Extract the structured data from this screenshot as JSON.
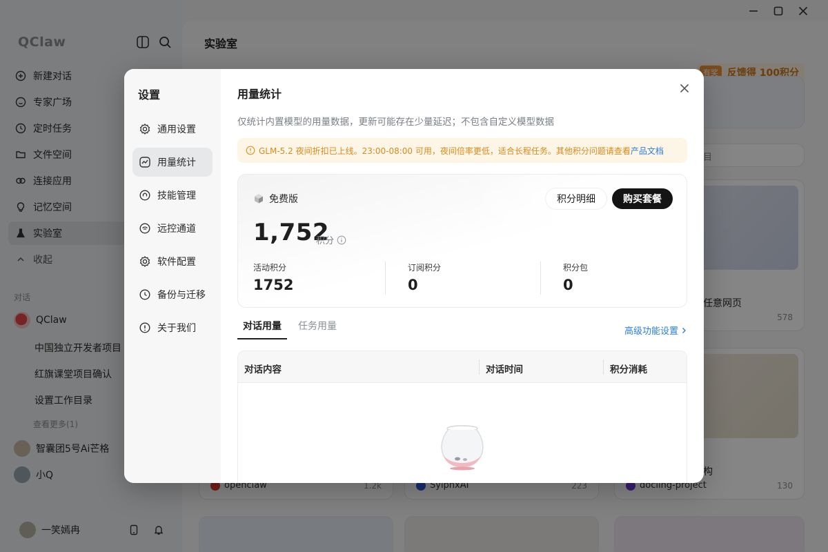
{
  "app": {
    "brand": "QClaw",
    "nav": [
      {
        "label": "新建对话",
        "icon": "plus-circle-icon"
      },
      {
        "label": "专家广场",
        "icon": "smile-icon"
      },
      {
        "label": "定时任务",
        "icon": "clock-icon"
      },
      {
        "label": "文件空间",
        "icon": "folder-icon"
      },
      {
        "label": "连接应用",
        "icon": "link-icon"
      },
      {
        "label": "记忆空间",
        "icon": "bulb-icon"
      },
      {
        "label": "实验室",
        "icon": "flask-icon"
      },
      {
        "label": "收起",
        "icon": "chevron-up-icon"
      }
    ],
    "conversations_label": "对话",
    "conversations": [
      {
        "label": "QClaw"
      },
      {
        "label": "中国独立开发者项目"
      },
      {
        "label": "红旗课堂项目确认"
      },
      {
        "label": "设置工作目录"
      }
    ],
    "see_more": "查看更多(1)",
    "experts": [
      {
        "label": "智囊团5号Ai芒格"
      },
      {
        "label": "小Q"
      }
    ],
    "user_name": "一笑嫣冉",
    "main_title": "实验室",
    "promo_tag": "有奖",
    "promo_text": "反馈得 100积分",
    "search_placeholder": "目",
    "cards": [
      {
        "title": "任意网页",
        "likes": "578"
      },
      {
        "title": "构",
        "likes": ""
      },
      {
        "author": "openclaw",
        "likes": "1.2k"
      },
      {
        "author": "SylphxAI",
        "likes": "223"
      },
      {
        "author": "docling-project",
        "likes": "130"
      }
    ]
  },
  "settings": {
    "title": "设置",
    "nav": [
      {
        "label": "通用设置",
        "icon": "gear-icon"
      },
      {
        "label": "用量统计",
        "icon": "chart-icon"
      },
      {
        "label": "技能管理",
        "icon": "skill-icon"
      },
      {
        "label": "远控通道",
        "icon": "remote-icon"
      },
      {
        "label": "软件配置",
        "icon": "gear-icon"
      },
      {
        "label": "备份与迁移",
        "icon": "clock-icon"
      },
      {
        "label": "关于我们",
        "icon": "info-icon"
      }
    ],
    "active_index": 1
  },
  "usage": {
    "title": "用量统计",
    "description": "仅统计内置模型的用量数据，更新可能存在少量延迟；不包含自定义模型数据",
    "notice_text": "GLM-5.2 夜间折扣已上线。23:00-08:00 可用，夜间倍率更低，适合长程任务。其他积分问题请查看",
    "notice_link": "产品文档",
    "plan": "免费版",
    "detail_button": "积分明细",
    "buy_button": "购买套餐",
    "total_points": "1,752",
    "points_unit": "积分",
    "stats": [
      {
        "label": "活动积分",
        "value": "1752"
      },
      {
        "label": "订阅积分",
        "value": "0"
      },
      {
        "label": "积分包",
        "value": "0"
      }
    ],
    "tabs": [
      "对话用量",
      "任务用量"
    ],
    "active_tab": 0,
    "advanced_link": "高级功能设置",
    "columns": [
      "对话内容",
      "对话时间",
      "积分消耗"
    ]
  },
  "colors": {
    "accent_link": "#2b7de0",
    "notice_text": "#d98a1c",
    "notice_bg": "#fdf6e7",
    "primary_button": "#141414"
  }
}
